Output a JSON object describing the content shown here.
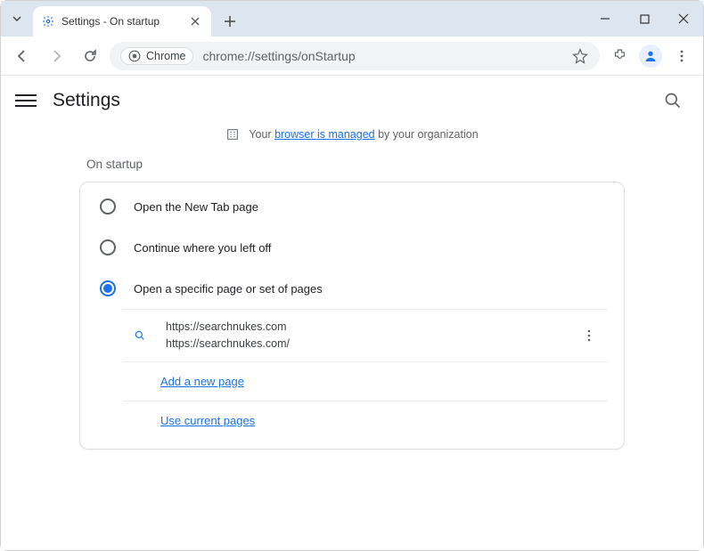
{
  "window": {
    "tab_title": "Settings - On startup",
    "chip_label": "Chrome",
    "url": "chrome://settings/onStartup"
  },
  "appbar": {
    "title": "Settings"
  },
  "managed": {
    "prefix": "Your ",
    "link": "browser is managed",
    "suffix": " by your organization"
  },
  "section": {
    "title": "On startup",
    "options": [
      {
        "label": "Open the New Tab page"
      },
      {
        "label": "Continue where you left off"
      },
      {
        "label": "Open a specific page or set of pages"
      }
    ],
    "selected_index": 2,
    "page": {
      "title": "https://searchnukes.com",
      "url": "https://searchnukes.com/"
    },
    "add_new_page": "Add a new page",
    "use_current": "Use current pages"
  }
}
